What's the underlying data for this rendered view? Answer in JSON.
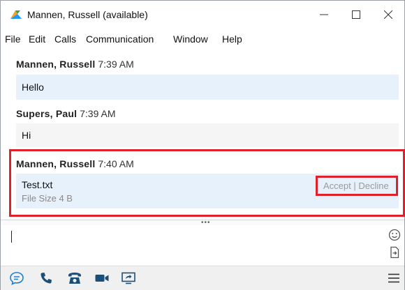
{
  "window": {
    "title": "Mannen, Russell (available)"
  },
  "menu": {
    "items": [
      "File",
      "Edit",
      "Calls",
      "Communication",
      "Window",
      "Help"
    ]
  },
  "messages": [
    {
      "sender": "Mannen, Russell",
      "time": "7:39 AM",
      "text": "Hello"
    },
    {
      "sender": "Supers, Paul",
      "time": "7:39 AM",
      "text": "Hi"
    },
    {
      "sender": "Mannen, Russell",
      "time": "7:40 AM"
    }
  ],
  "file_transfer": {
    "file_name": "Test.txt",
    "file_size": "File Size 4 B",
    "accept_label": "Accept",
    "separator": "|",
    "decline_label": "Decline"
  },
  "colors": {
    "bubble_self": "#e6f1fb",
    "bubble_other": "#f5f5f5",
    "highlight": "#e0202a",
    "accent": "#1b7fd0"
  }
}
